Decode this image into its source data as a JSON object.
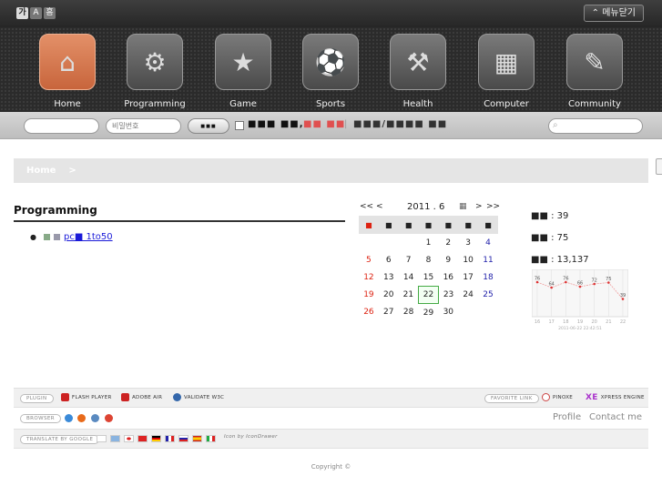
{
  "top": {
    "font_sizes": [
      "가",
      "A",
      "흠"
    ],
    "menu_close_label": "⌃ 메뉴닫기"
  },
  "nav": [
    {
      "label": "Home",
      "icon": "house-icon",
      "active": true
    },
    {
      "label": "Programming",
      "icon": "gears-icon"
    },
    {
      "label": "Game",
      "icon": "starcraft-icon"
    },
    {
      "label": "Sports",
      "icon": "runner-icon"
    },
    {
      "label": "Health",
      "icon": "dumbbell-icon"
    },
    {
      "label": "Computer",
      "icon": "windows-icon"
    },
    {
      "label": "Community",
      "icon": "notepad-icon"
    }
  ],
  "login": {
    "id_placeholder": "",
    "password_placeholder": "비밀번호",
    "login_button": "■■■",
    "keep_label": "■■■ ■■,",
    "join_link": "■■ ■■",
    "find_link": "■■■/■■■■ ■■",
    "search_placeholder": ""
  },
  "breadcrumb": {
    "home": "Home",
    "sep": ">"
  },
  "section": {
    "title": "Programming",
    "items": [
      {
        "label": "pc■ 1to50"
      }
    ]
  },
  "calendar": {
    "prev_year": "<<",
    "prev_month": "<",
    "title": "2011 . 6",
    "next_month": ">",
    "next_year": ">>",
    "weekdays": [
      "■",
      "■",
      "■",
      "■",
      "■",
      "■",
      "■"
    ],
    "weeks": [
      [
        "",
        "",
        "",
        "1",
        "2",
        "3",
        "4"
      ],
      [
        "5",
        "6",
        "7",
        "8",
        "9",
        "10",
        "11"
      ],
      [
        "12",
        "13",
        "14",
        "15",
        "16",
        "17",
        "18"
      ],
      [
        "19",
        "20",
        "21",
        "22",
        "23",
        "24",
        "25"
      ],
      [
        "26",
        "27",
        "28",
        "29",
        "30",
        "",
        ""
      ]
    ],
    "today": "22"
  },
  "stats": {
    "today": "■■ : 39",
    "yesterday": "■■ : 75",
    "total": "■■ : 13,137"
  },
  "chart_data": {
    "type": "line",
    "x": [
      "16",
      "17",
      "18",
      "19",
      "20",
      "21",
      "22"
    ],
    "values": [
      76,
      64,
      76,
      66,
      72,
      75,
      39
    ],
    "ylim": [
      0,
      100
    ],
    "footer": "2011-06-22 22:42:51"
  },
  "footer": {
    "plugin_label": "PLUGIN",
    "flash": "FLASH PLAYER",
    "air": "ADOBE AIR",
    "w3c": "VALIDATE W3C",
    "favorite_label": "FAVORITE LINK",
    "pinoxe": "PINOXE",
    "xe": "XPRESS ENGINE",
    "browser_label": "BROWSER",
    "profile": "Profile",
    "contact": "Contact me",
    "translate_label": "TRANSLATE BY GOOGLE",
    "icon_credit": "Icon by IconDrawer",
    "copyright": "Copyright ©"
  }
}
